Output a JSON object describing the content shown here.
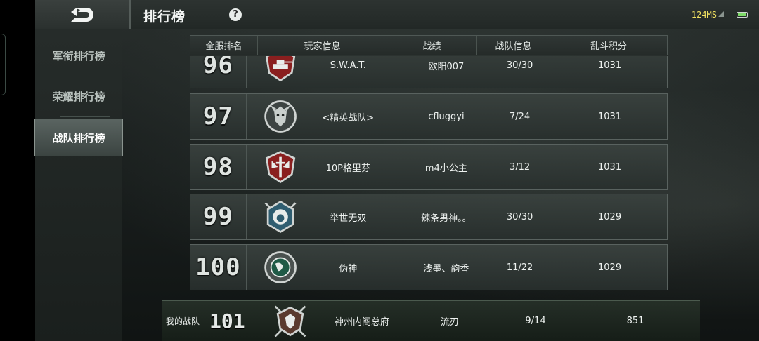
{
  "topbar": {
    "title": "排行榜",
    "help": "?",
    "ping": "124MS"
  },
  "sidebar": {
    "items": [
      {
        "label": "军衔排行榜",
        "active": false
      },
      {
        "label": "荣耀排行榜",
        "active": false
      },
      {
        "label": "战队排行榜",
        "active": true
      }
    ]
  },
  "table": {
    "headers": [
      "全服排名",
      "玩家信息",
      "战绩",
      "战队信息",
      "乱斗积分"
    ],
    "rows": [
      {
        "rank": "96",
        "team": "S.W.A.T.",
        "record": "欧阳007",
        "team_info": "30/30",
        "score": "1031",
        "emblem": "tank-emblem"
      },
      {
        "rank": "97",
        "team": "<精英战队>",
        "record": "cfluggyi",
        "team_info": "7/24",
        "score": "1031",
        "emblem": "wolf-emblem"
      },
      {
        "rank": "98",
        "team": "10P格里芬",
        "record": "m4小公主",
        "team_info": "3/12",
        "score": "1031",
        "emblem": "sword-wings-emblem"
      },
      {
        "rank": "99",
        "team": "举世无双",
        "record": "辣条男神。。",
        "team_info": "30/30",
        "score": "1029",
        "emblem": "lion-emblem"
      },
      {
        "rank": "100",
        "team": "伪神",
        "record": "浅墨、韵香",
        "team_info": "11/22",
        "score": "1029",
        "emblem": "globe-emblem"
      }
    ]
  },
  "my_team": {
    "label": "我的战队",
    "rank": "101",
    "team": "神州内阁总府",
    "record": "流刃",
    "team_info": "9/14",
    "score": "851",
    "emblem": "wolf-crossed-swords-emblem"
  },
  "colors": {
    "ping": "#f0e060",
    "battery": "#7fdc6a",
    "active_tab": "#5a6461"
  }
}
